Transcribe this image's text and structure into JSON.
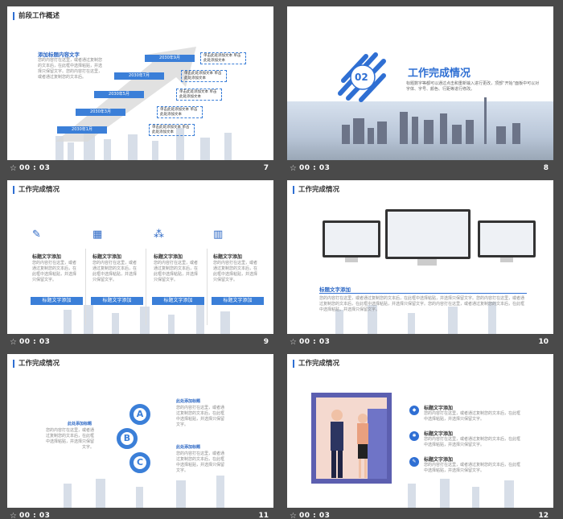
{
  "footer_time": "00 : 03",
  "slides": [
    {
      "number": "7",
      "title": "前段工作概述",
      "heading": "添加标题内容文字",
      "body": "您的内容打在这里，或者通过复制您的文本后，在此框中选择粘贴，并选择只保留文字。您的内容打在这里，或者通过复制您的文本后。",
      "dates": [
        "2030年1月",
        "2030年3月",
        "2030年5月",
        "2030年7月",
        "2030年9月"
      ],
      "box_text": "单击此处添加文本\n单击此处添加文本"
    },
    {
      "number": "8",
      "section_no": "02",
      "title": "工作完成情况",
      "body": "标题数字等都可以通过点击和重新输入进行更改，顶部“开始”面板中可以对字体、字号、颜色、行距等进行修改。"
    },
    {
      "number": "9",
      "title": "工作完成情况",
      "cards": [
        {
          "icon": "pen-icon",
          "heading": "标题文字添加",
          "body": "您的内容打在这里，或者通过复制您的文本后，在此框中选择粘贴，并选择只保留文字。",
          "button": "标题文字添加"
        },
        {
          "icon": "chart-icon",
          "heading": "标题文字添加",
          "body": "您的内容打在这里，或者通过复制您的文本后，在此框中选择粘贴，并选择只保留文字。",
          "button": "标题文字添加"
        },
        {
          "icon": "team-icon",
          "heading": "标题文字添加",
          "body": "您的内容打在这里，或者通过复制您的文本后，在此框中选择粘贴，并选择只保留文字。",
          "button": "标题文字添加"
        },
        {
          "icon": "bar-chart-icon",
          "heading": "标题文字添加",
          "body": "您的内容打在这里，或者通过复制您的文本后，在此框中选择粘贴，并选择只保留文字。",
          "button": "标题文字添加"
        }
      ]
    },
    {
      "number": "10",
      "title": "工作完成情况",
      "heading": "标题文字添加",
      "body": "您的内容打在这里，或者通过复制您的文本后，在此框中选择粘贴，并选择只保留文字。您的内容打在这里，或者通过复制您的文本后，在此框中选择粘贴，并选择只保留文字。您的内容打在这里，或者通过复制您的文本后，在此框中选择粘贴，并选择只保留文字。"
    },
    {
      "number": "11",
      "title": "工作完成情况",
      "letters": [
        "A",
        "B",
        "C"
      ],
      "items": [
        {
          "heading": "此处添加标题",
          "body": "您的内容打在这里，或者通过复制您的文本后，在此框中选择粘贴，并选择只保留文字。"
        },
        {
          "heading": "此处添加标题",
          "body": "您的内容打在这里，或者通过复制您的文本后，在此框中选择粘贴，并选择只保留文字。"
        },
        {
          "heading": "此处添加标题",
          "body": "您的内容打在这里，或者通过复制您的文本后，在此框中选择粘贴，并选择只保留文字。"
        }
      ]
    },
    {
      "number": "12",
      "title": "工作完成情况",
      "items": [
        {
          "icon": "drop-icon",
          "heading": "标题文字添加",
          "body": "您的内容打在这里，或者通过复制您的文本后，在此框中选择粘贴，并选择只保留文字。"
        },
        {
          "icon": "gear-icon",
          "heading": "标题文字添加",
          "body": "您的内容打在这里，或者通过复制您的文本后，在此框中选择粘贴，并选择只保留文字。"
        },
        {
          "icon": "edit-icon",
          "heading": "标题文字添加",
          "body": "您的内容打在这里，或者通过复制您的文本后，在此框中选择粘贴，并选择只保留文字。"
        }
      ]
    }
  ],
  "colors": {
    "accent": "#2f6fd3",
    "background": "#4a4a4a",
    "footer_text": "#ffffff"
  }
}
